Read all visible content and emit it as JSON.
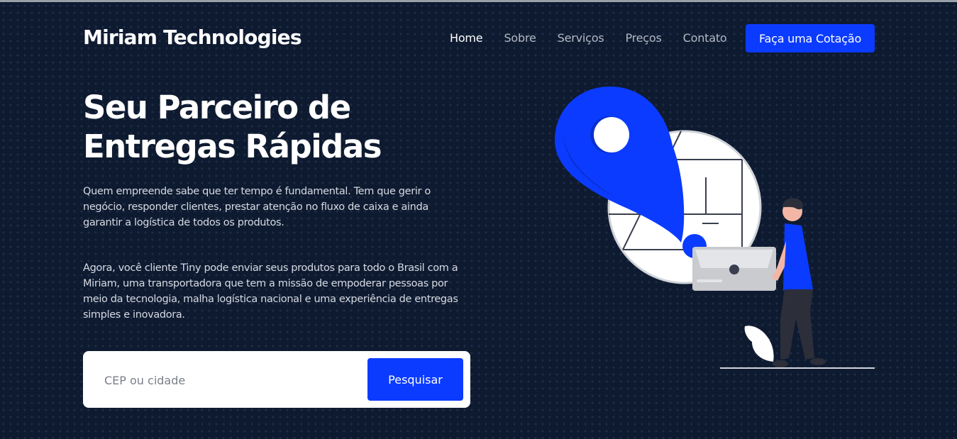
{
  "header": {
    "brand": "Miriam Technologies",
    "nav": [
      "Home",
      "Sobre",
      "Serviços",
      "Preços",
      "Contato"
    ],
    "active_nav": "Home",
    "cta_label": "Faça uma Cotação"
  },
  "hero": {
    "title_line1": "Seu Parceiro de",
    "title_line2": "Entregas Rápidas",
    "paragraph1": "Quem empreende sabe que ter tempo é fundamental. Tem que gerir o negócio, responder clientes, prestar atenção no fluxo de caixa e ainda garantir a logística de todos os produtos.",
    "paragraph2": "Agora, você cliente Tiny pode enviar seus produtos para todo o Brasil com a Miriam, uma transportadora que tem a missão de empoderar pessoas por meio da tecnologia, malha logística nacional e uma experiência de entregas simples e inovadora."
  },
  "search": {
    "placeholder": "CEP ou cidade",
    "value": "",
    "button_label": "Pesquisar"
  },
  "colors": {
    "background": "#0e1a30",
    "accent": "#0b3bff"
  },
  "illustration": {
    "icon": "map-pin-delivery-person-illustration"
  }
}
